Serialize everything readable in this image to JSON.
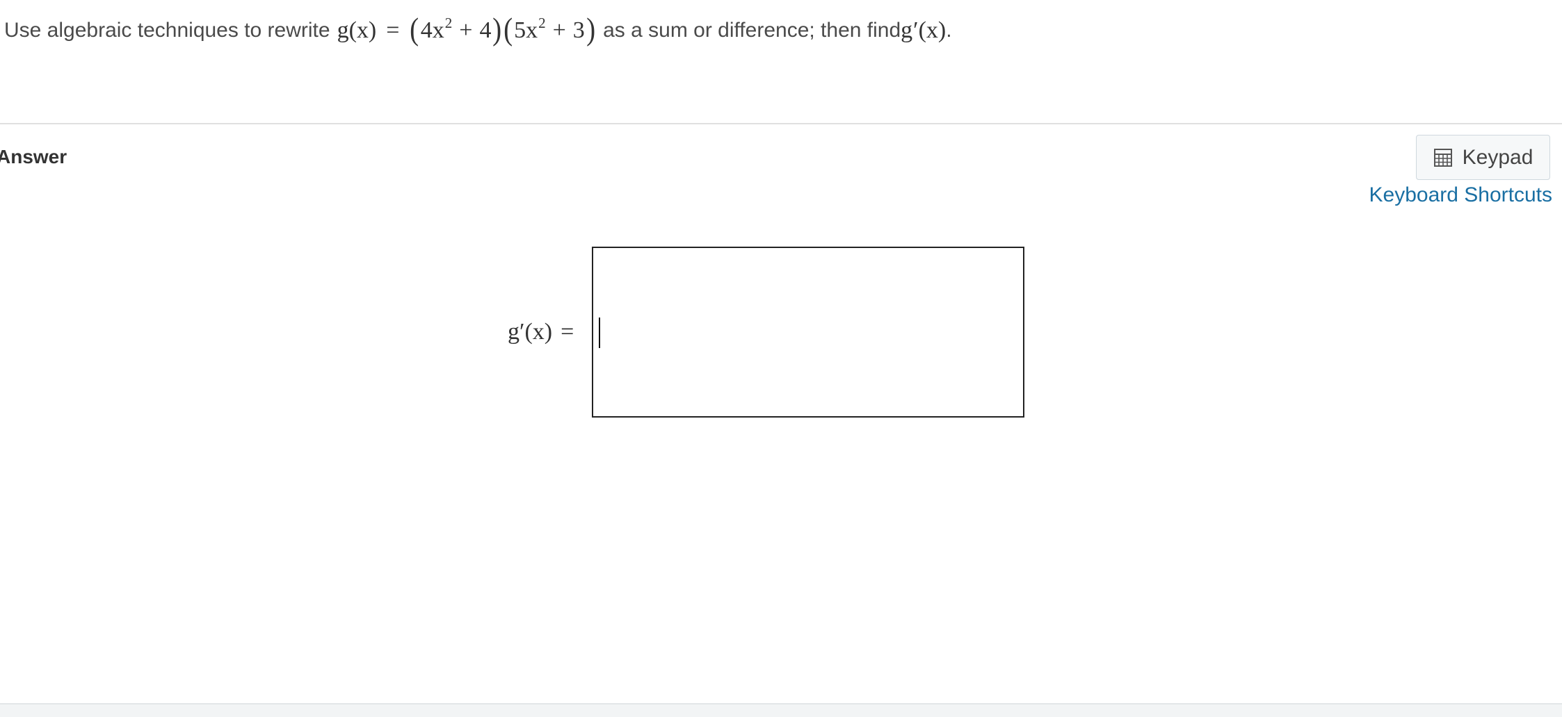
{
  "question": {
    "prefix": "Use algebraic techniques to rewrite ",
    "suffix_mid": " as a sum or difference; then find ",
    "suffix_end": ".",
    "math": {
      "g": "g",
      "x": "x",
      "lparen": "(",
      "rparen": ")",
      "equals": "=",
      "plus": "+",
      "coef1": "4",
      "var": "x",
      "exp": "2",
      "const1": "4",
      "coef2": "5",
      "const2": "3",
      "prime": "′"
    }
  },
  "answer": {
    "label": "Answer",
    "keypad_label": "Keypad",
    "shortcuts_label": "Keyboard Shortcuts",
    "lhs": {
      "g": "g",
      "prime": "′",
      "arg": "(x)",
      "equals": "="
    },
    "input_value": ""
  },
  "colors": {
    "link": "#1a6fa3",
    "text": "#333333",
    "divider": "#e0e0e0",
    "button_bg": "#f6f8f9"
  },
  "icons": {
    "keypad": "calculator-icon"
  }
}
